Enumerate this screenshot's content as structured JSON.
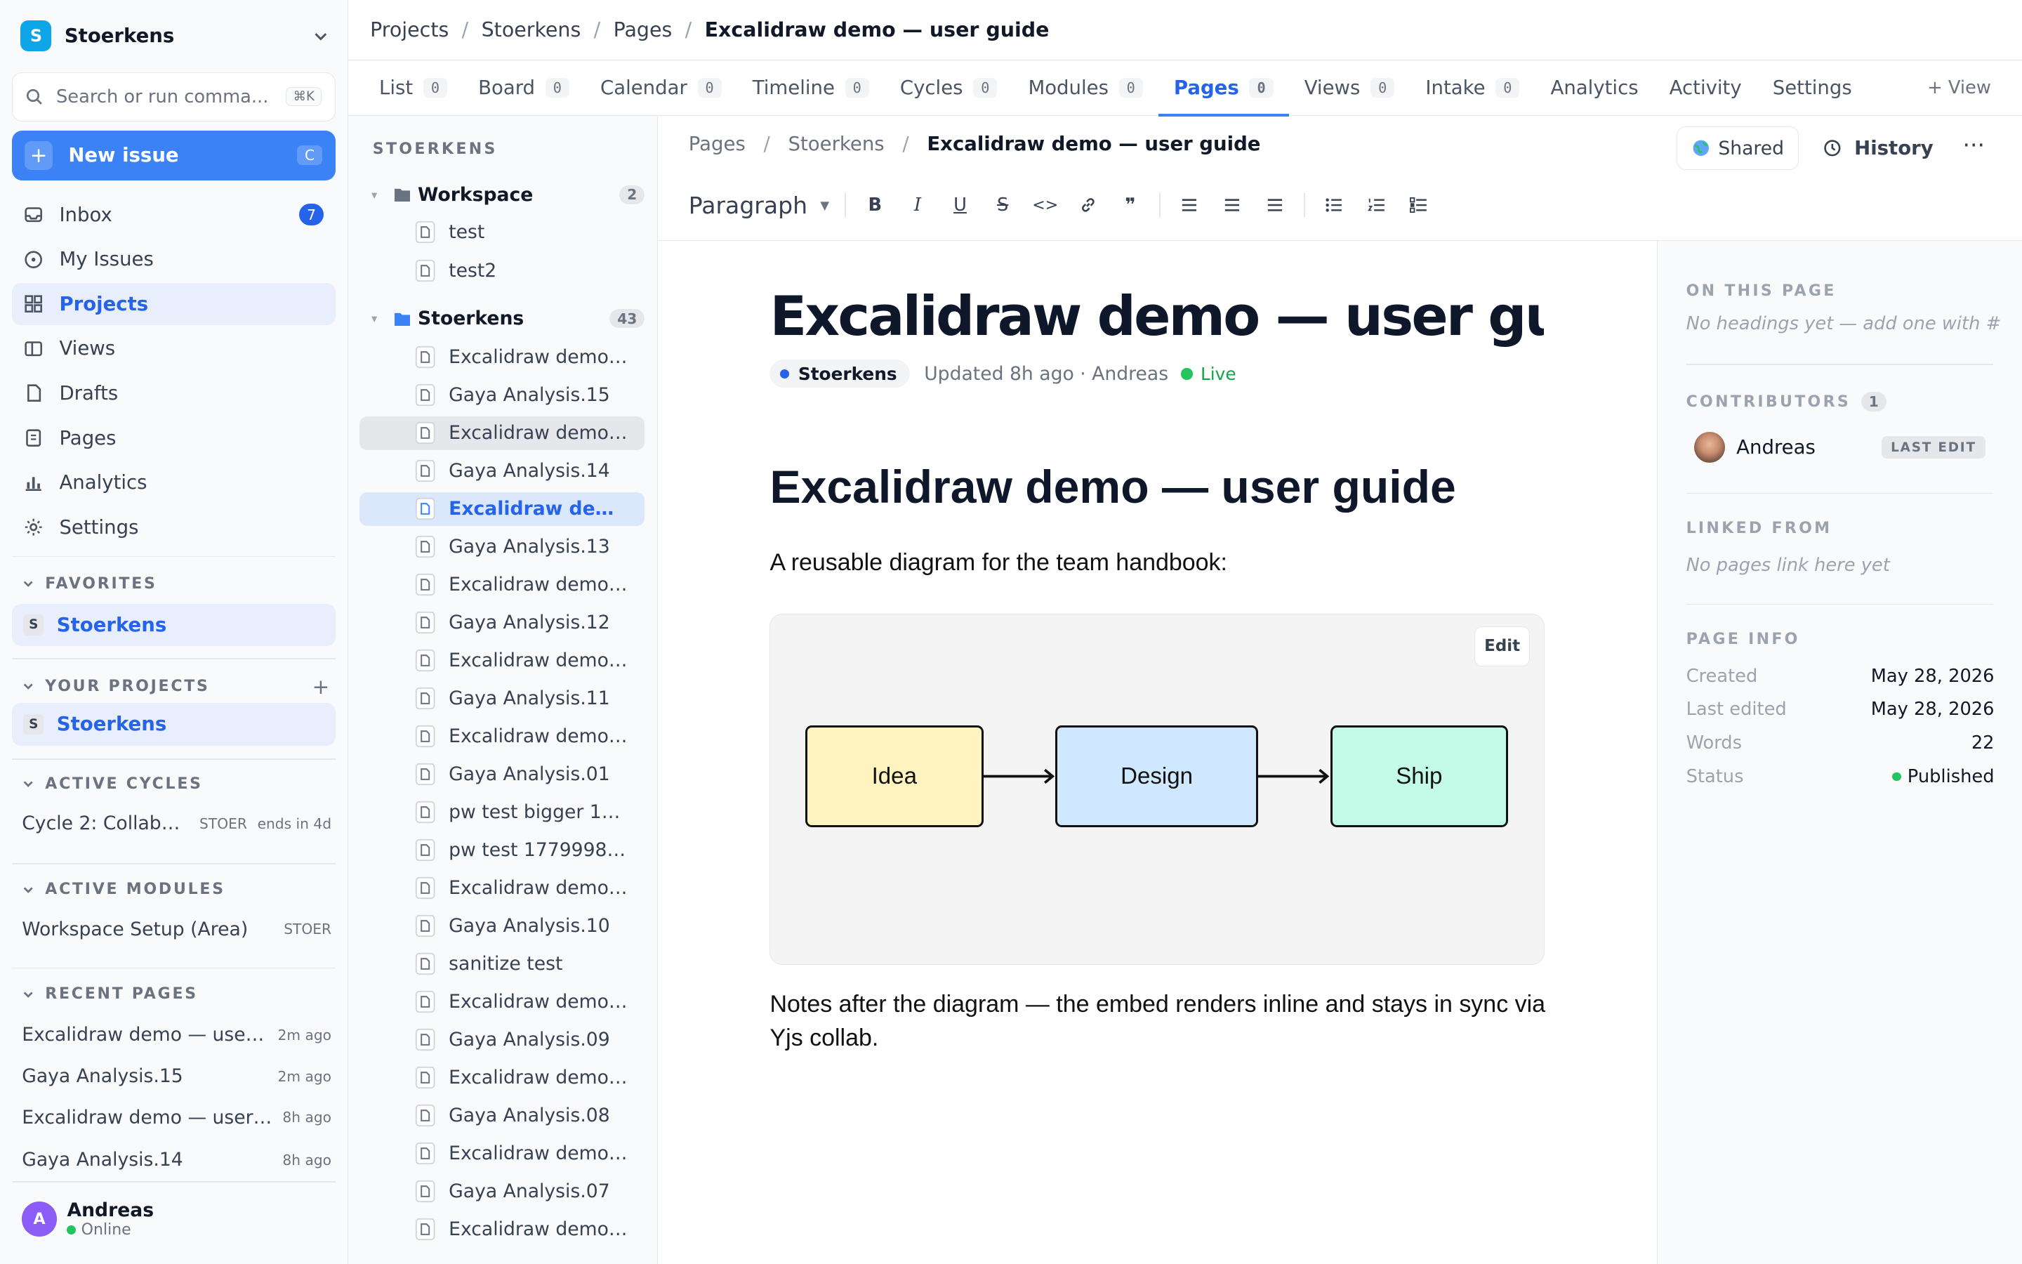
{
  "workspace": {
    "name": "Stoerkens",
    "initial": "S"
  },
  "search": {
    "placeholder": "Search or run comma...",
    "shortcut": "⌘K"
  },
  "new_issue": {
    "label": "New issue",
    "shortcut": "C"
  },
  "nav": [
    {
      "label": "Inbox",
      "icon": "inbox-icon",
      "badge": "7"
    },
    {
      "label": "My Issues",
      "icon": "target-icon"
    },
    {
      "label": "Projects",
      "icon": "grid-icon",
      "active": true
    },
    {
      "label": "Views",
      "icon": "views-icon"
    },
    {
      "label": "Drafts",
      "icon": "draft-icon"
    },
    {
      "label": "Pages",
      "icon": "pages-icon"
    },
    {
      "label": "Analytics",
      "icon": "bar-chart-icon"
    },
    {
      "label": "Settings",
      "icon": "gear-icon"
    }
  ],
  "favorites": {
    "heading": "FAVORITES",
    "item": "Stoerkens",
    "initial": "S"
  },
  "your_projects": {
    "heading": "YOUR PROJECTS",
    "item": "Stoerkens",
    "initial": "S"
  },
  "active_cycles": {
    "heading": "ACTIVE CYCLES",
    "name": "Cycle 2: Collabo...",
    "code": "STOER",
    "meta": "ends in 4d"
  },
  "active_modules": {
    "heading": "ACTIVE MODULES",
    "name": "Workspace Setup (Area)",
    "code": "STOER"
  },
  "recent_pages": {
    "heading": "RECENT PAGES",
    "items": [
      {
        "title": "Excalidraw demo — user ...",
        "time": "2m ago"
      },
      {
        "title": "Gaya Analysis.15",
        "time": "2m ago"
      },
      {
        "title": "Excalidraw demo — user ...",
        "time": "8h ago"
      },
      {
        "title": "Gaya Analysis.14",
        "time": "8h ago"
      }
    ]
  },
  "user": {
    "name": "Andreas",
    "initial": "A",
    "status": "Online"
  },
  "breadcrumb": [
    "Projects",
    "Stoerkens",
    "Pages",
    "Excalidraw demo — user guide"
  ],
  "tabs": [
    {
      "label": "List",
      "count": "0"
    },
    {
      "label": "Board",
      "count": "0"
    },
    {
      "label": "Calendar",
      "count": "0"
    },
    {
      "label": "Timeline",
      "count": "0"
    },
    {
      "label": "Cycles",
      "count": "0"
    },
    {
      "label": "Modules",
      "count": "0"
    },
    {
      "label": "Pages",
      "count": "0",
      "active": true
    },
    {
      "label": "Views",
      "count": "0"
    },
    {
      "label": "Intake",
      "count": "0"
    },
    {
      "label": "Analytics"
    },
    {
      "label": "Activity"
    },
    {
      "label": "Settings"
    }
  ],
  "add_view": "+ View",
  "tree": {
    "heading": "STOERKENS",
    "workspace_folder": {
      "name": "Workspace",
      "count": "2",
      "items": [
        "test",
        "test2"
      ]
    },
    "project_folder": {
      "name": "Stoerkens",
      "count": "43"
    },
    "items": [
      "Excalidraw demo ...",
      "Gaya Analysis.15",
      "Excalidraw demo ...",
      "Gaya Analysis.14",
      "Excalidraw demo ...",
      "Gaya Analysis.13",
      "Excalidraw demo ...",
      "Gaya Analysis.12",
      "Excalidraw demo ...",
      "Gaya Analysis.11",
      "Excalidraw demo ...",
      "Gaya Analysis.01",
      "pw test bigger 177...",
      "pw test 177999833...",
      "Excalidraw demo ...",
      "Gaya Analysis.10",
      "sanitize test",
      "Excalidraw demo ...",
      "Gaya Analysis.09",
      "Excalidraw demo ...",
      "Gaya Analysis.08",
      "Excalidraw demo ...",
      "Gaya Analysis.07",
      "Excalidraw demo ..."
    ],
    "hovered_index": 2,
    "selected_index": 4
  },
  "editor": {
    "breadcrumb": [
      "Pages",
      "Stoerkens",
      "Excalidraw demo — user guide"
    ],
    "shared_label": "Shared",
    "history_label": "History",
    "block_type": "Paragraph",
    "title": "Excalidraw demo — user guide",
    "project_chip": "Stoerkens",
    "updated": "Updated 8h ago · Andreas",
    "live": "Live",
    "heading": "Excalidraw demo — user guide",
    "intro": "A reusable diagram for the team handbook:",
    "embed_edit": "Edit",
    "diagram": [
      {
        "label": "Idea",
        "color": "#fff3bf"
      },
      {
        "label": "Design",
        "color": "#d0e8ff"
      },
      {
        "label": "Ship",
        "color": "#c3fae8"
      }
    ],
    "notes": "Notes after the diagram — the embed renders inline and stays in sync via Yjs collab."
  },
  "right_panel": {
    "on_this_page": "ON THIS PAGE",
    "on_this_page_empty": "No headings yet — add one with #",
    "contributors": "CONTRIBUTORS",
    "contributors_count": "1",
    "contributor_name": "Andreas",
    "last_edit": "LAST EDIT",
    "linked_from": "LINKED FROM",
    "linked_empty": "No pages link here yet",
    "page_info": "PAGE INFO",
    "info": [
      {
        "label": "Created",
        "value": "May 28, 2026"
      },
      {
        "label": "Last edited",
        "value": "May 28, 2026"
      },
      {
        "label": "Words",
        "value": "22"
      },
      {
        "label": "Status",
        "value": "Published"
      }
    ]
  }
}
